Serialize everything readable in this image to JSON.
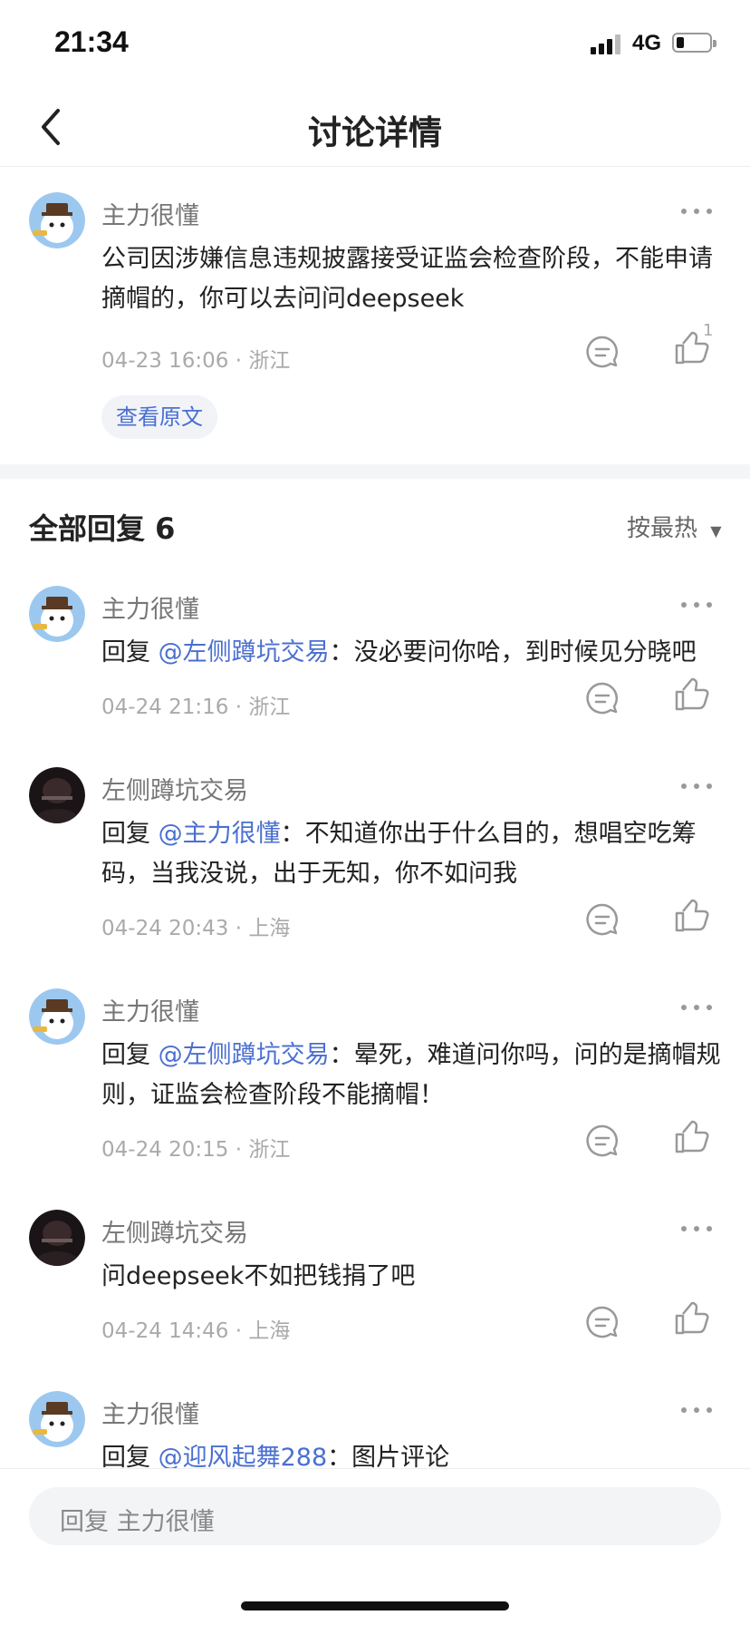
{
  "status": {
    "time": "21:34",
    "network": "4G"
  },
  "header": {
    "title": "讨论详情"
  },
  "main_post": {
    "author": "主力很懂",
    "content": "公司因涉嫌信息违规披露接受证监会检查阶段，不能申请摘帽的，你可以去问问deepseek",
    "meta": "04-23 16:06 · 浙江",
    "like_count": "1",
    "view_original": "查看原文"
  },
  "replies_header": {
    "title": "全部回复 6",
    "sort": "按最热"
  },
  "replies": [
    {
      "author": "主力很懂",
      "prefix": "回复 ",
      "mention": "@左侧蹲坑交易",
      "text": "：没必要问你哈，到时候见分晓吧",
      "meta": "04-24 21:16 · 浙江"
    },
    {
      "author": "左侧蹲坑交易",
      "prefix": "回复 ",
      "mention": "@主力很懂",
      "text": "：不知道你出于什么目的，想唱空吃筹码，当我没说，出于无知，你不如问我",
      "meta": "04-24 20:43 · 上海"
    },
    {
      "author": "主力很懂",
      "prefix": "回复 ",
      "mention": "@左侧蹲坑交易",
      "text": "：晕死，难道问你吗，问的是摘帽规则，证监会检查阶段不能摘帽！",
      "meta": "04-24 20:15 · 浙江"
    },
    {
      "author": "左侧蹲坑交易",
      "prefix": "",
      "mention": "",
      "text": "问deepseek不如把钱捐了吧",
      "meta": "04-24 14:46 · 上海"
    },
    {
      "author": "主力很懂",
      "prefix": "回复 ",
      "mention": "@迎风起舞288",
      "text": "：图片评论",
      "meta": ""
    }
  ],
  "reply_input": {
    "placeholder": "回复 主力很懂"
  },
  "colors": {
    "accent": "#4a6fd1",
    "muted": "#aaaaaa"
  }
}
